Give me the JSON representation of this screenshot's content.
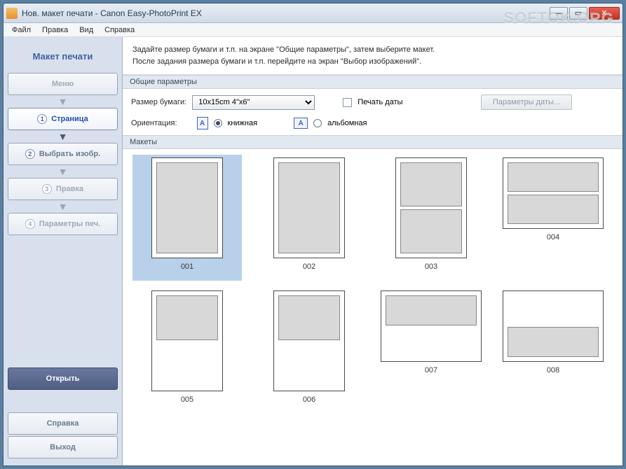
{
  "window": {
    "title": "Нов. макет печати - Canon Easy-PhotoPrint EX",
    "watermark": "SOFTOK.ORG"
  },
  "menubar": {
    "items": [
      "Файл",
      "Правка",
      "Вид",
      "Справка"
    ]
  },
  "sidebar": {
    "title": "Макет печати",
    "steps": {
      "menu": "Меню",
      "page": "Страница",
      "select_images": "Выбрать изобр.",
      "edit": "Правка",
      "print_params": "Параметры печ."
    },
    "open": "Открыть",
    "help": "Справка",
    "exit": "Выход"
  },
  "instructions": {
    "line1": "Задайте размер бумаги и т.п. на экране \"Общие параметры\", затем выберите макет.",
    "line2": "После задания размера бумаги и т.п. перейдите на экран \"Выбор изображений\"."
  },
  "params": {
    "section_label": "Общие параметры",
    "paper_label": "Размер бумаги:",
    "paper_value": "10x15cm 4\"x6\"",
    "print_date_label": "Печать даты",
    "date_params_btn": "Параметры даты...",
    "orientation_label": "Ориентация:",
    "portrait": "книжная",
    "landscape": "альбомная",
    "orientation_value": "portrait"
  },
  "layouts": {
    "section_label": "Макеты",
    "items": [
      {
        "id": "001",
        "orientation": "portrait",
        "cells": 1,
        "selected": true
      },
      {
        "id": "002",
        "orientation": "portrait",
        "cells": 1,
        "selected": false
      },
      {
        "id": "003",
        "orientation": "portrait",
        "cells": 2,
        "selected": false
      },
      {
        "id": "004",
        "orientation": "landscape",
        "cells": 2,
        "selected": false
      },
      {
        "id": "005",
        "orientation": "portrait",
        "cells": 2,
        "half": "top",
        "selected": false
      },
      {
        "id": "006",
        "orientation": "portrait",
        "cells": 2,
        "half": "top",
        "selected": false
      },
      {
        "id": "007",
        "orientation": "landscape",
        "cells": 2,
        "half": "top",
        "selected": false
      },
      {
        "id": "008",
        "orientation": "landscape",
        "cells": 2,
        "half": "bottom",
        "selected": false
      }
    ]
  }
}
